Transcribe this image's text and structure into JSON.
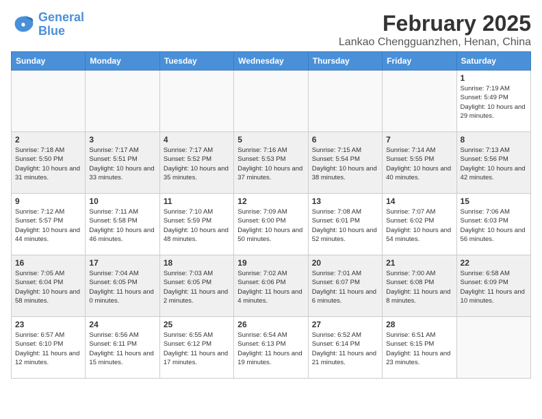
{
  "logo": {
    "line1": "General",
    "line2": "Blue"
  },
  "title": "February 2025",
  "location": "Lankao Chengguanzhen, Henan, China",
  "weekdays": [
    "Sunday",
    "Monday",
    "Tuesday",
    "Wednesday",
    "Thursday",
    "Friday",
    "Saturday"
  ],
  "weeks": [
    [
      {
        "day": "",
        "info": ""
      },
      {
        "day": "",
        "info": ""
      },
      {
        "day": "",
        "info": ""
      },
      {
        "day": "",
        "info": ""
      },
      {
        "day": "",
        "info": ""
      },
      {
        "day": "",
        "info": ""
      },
      {
        "day": "1",
        "info": "Sunrise: 7:19 AM\nSunset: 5:49 PM\nDaylight: 10 hours and 29 minutes."
      }
    ],
    [
      {
        "day": "2",
        "info": "Sunrise: 7:18 AM\nSunset: 5:50 PM\nDaylight: 10 hours and 31 minutes."
      },
      {
        "day": "3",
        "info": "Sunrise: 7:17 AM\nSunset: 5:51 PM\nDaylight: 10 hours and 33 minutes."
      },
      {
        "day": "4",
        "info": "Sunrise: 7:17 AM\nSunset: 5:52 PM\nDaylight: 10 hours and 35 minutes."
      },
      {
        "day": "5",
        "info": "Sunrise: 7:16 AM\nSunset: 5:53 PM\nDaylight: 10 hours and 37 minutes."
      },
      {
        "day": "6",
        "info": "Sunrise: 7:15 AM\nSunset: 5:54 PM\nDaylight: 10 hours and 38 minutes."
      },
      {
        "day": "7",
        "info": "Sunrise: 7:14 AM\nSunset: 5:55 PM\nDaylight: 10 hours and 40 minutes."
      },
      {
        "day": "8",
        "info": "Sunrise: 7:13 AM\nSunset: 5:56 PM\nDaylight: 10 hours and 42 minutes."
      }
    ],
    [
      {
        "day": "9",
        "info": "Sunrise: 7:12 AM\nSunset: 5:57 PM\nDaylight: 10 hours and 44 minutes."
      },
      {
        "day": "10",
        "info": "Sunrise: 7:11 AM\nSunset: 5:58 PM\nDaylight: 10 hours and 46 minutes."
      },
      {
        "day": "11",
        "info": "Sunrise: 7:10 AM\nSunset: 5:59 PM\nDaylight: 10 hours and 48 minutes."
      },
      {
        "day": "12",
        "info": "Sunrise: 7:09 AM\nSunset: 6:00 PM\nDaylight: 10 hours and 50 minutes."
      },
      {
        "day": "13",
        "info": "Sunrise: 7:08 AM\nSunset: 6:01 PM\nDaylight: 10 hours and 52 minutes."
      },
      {
        "day": "14",
        "info": "Sunrise: 7:07 AM\nSunset: 6:02 PM\nDaylight: 10 hours and 54 minutes."
      },
      {
        "day": "15",
        "info": "Sunrise: 7:06 AM\nSunset: 6:03 PM\nDaylight: 10 hours and 56 minutes."
      }
    ],
    [
      {
        "day": "16",
        "info": "Sunrise: 7:05 AM\nSunset: 6:04 PM\nDaylight: 10 hours and 58 minutes."
      },
      {
        "day": "17",
        "info": "Sunrise: 7:04 AM\nSunset: 6:05 PM\nDaylight: 11 hours and 0 minutes."
      },
      {
        "day": "18",
        "info": "Sunrise: 7:03 AM\nSunset: 6:05 PM\nDaylight: 11 hours and 2 minutes."
      },
      {
        "day": "19",
        "info": "Sunrise: 7:02 AM\nSunset: 6:06 PM\nDaylight: 11 hours and 4 minutes."
      },
      {
        "day": "20",
        "info": "Sunrise: 7:01 AM\nSunset: 6:07 PM\nDaylight: 11 hours and 6 minutes."
      },
      {
        "day": "21",
        "info": "Sunrise: 7:00 AM\nSunset: 6:08 PM\nDaylight: 11 hours and 8 minutes."
      },
      {
        "day": "22",
        "info": "Sunrise: 6:58 AM\nSunset: 6:09 PM\nDaylight: 11 hours and 10 minutes."
      }
    ],
    [
      {
        "day": "23",
        "info": "Sunrise: 6:57 AM\nSunset: 6:10 PM\nDaylight: 11 hours and 12 minutes."
      },
      {
        "day": "24",
        "info": "Sunrise: 6:56 AM\nSunset: 6:11 PM\nDaylight: 11 hours and 15 minutes."
      },
      {
        "day": "25",
        "info": "Sunrise: 6:55 AM\nSunset: 6:12 PM\nDaylight: 11 hours and 17 minutes."
      },
      {
        "day": "26",
        "info": "Sunrise: 6:54 AM\nSunset: 6:13 PM\nDaylight: 11 hours and 19 minutes."
      },
      {
        "day": "27",
        "info": "Sunrise: 6:52 AM\nSunset: 6:14 PM\nDaylight: 11 hours and 21 minutes."
      },
      {
        "day": "28",
        "info": "Sunrise: 6:51 AM\nSunset: 6:15 PM\nDaylight: 11 hours and 23 minutes."
      },
      {
        "day": "",
        "info": ""
      }
    ]
  ]
}
